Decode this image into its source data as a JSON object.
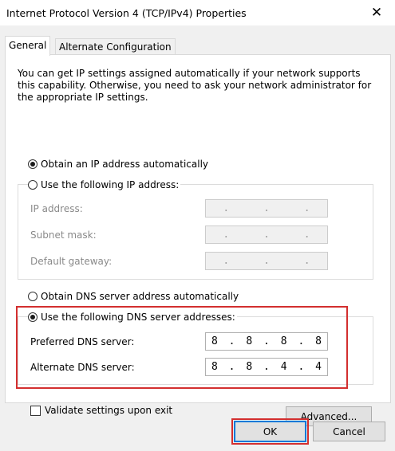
{
  "window": {
    "title": "Internet Protocol Version 4 (TCP/IPv4) Properties",
    "close_glyph": "✕"
  },
  "tabs": [
    {
      "label": "General",
      "active": true
    },
    {
      "label": "Alternate Configuration",
      "active": false
    }
  ],
  "description": "You can get IP settings assigned automatically if your network supports this capability. Otherwise, you need to ask your network administrator for the appropriate IP settings.",
  "ip": {
    "auto_label": "Obtain an IP address automatically",
    "auto_selected": true,
    "manual_label": "Use the following IP address:",
    "manual_selected": false,
    "fields": [
      {
        "label": "IP address:",
        "octets": [
          "",
          "",
          "",
          ""
        ]
      },
      {
        "label": "Subnet mask:",
        "octets": [
          "",
          "",
          "",
          ""
        ]
      },
      {
        "label": "Default gateway:",
        "octets": [
          "",
          "",
          "",
          ""
        ]
      }
    ]
  },
  "dns": {
    "auto_label": "Obtain DNS server address automatically",
    "auto_selected": false,
    "manual_label": "Use the following DNS server addresses:",
    "manual_selected": true,
    "preferred": {
      "label": "Preferred DNS server:",
      "octets": [
        "8",
        "8",
        "8",
        "8"
      ]
    },
    "alternate": {
      "label": "Alternate DNS server:",
      "octets": [
        "8",
        "8",
        "4",
        "4"
      ]
    }
  },
  "validate": {
    "label": "Validate settings upon exit",
    "checked": false
  },
  "buttons": {
    "advanced": "Advanced...",
    "ok": "OK",
    "cancel": "Cancel"
  },
  "colors": {
    "highlight": "#d32f2f",
    "default_button_border": "#0078d7"
  }
}
